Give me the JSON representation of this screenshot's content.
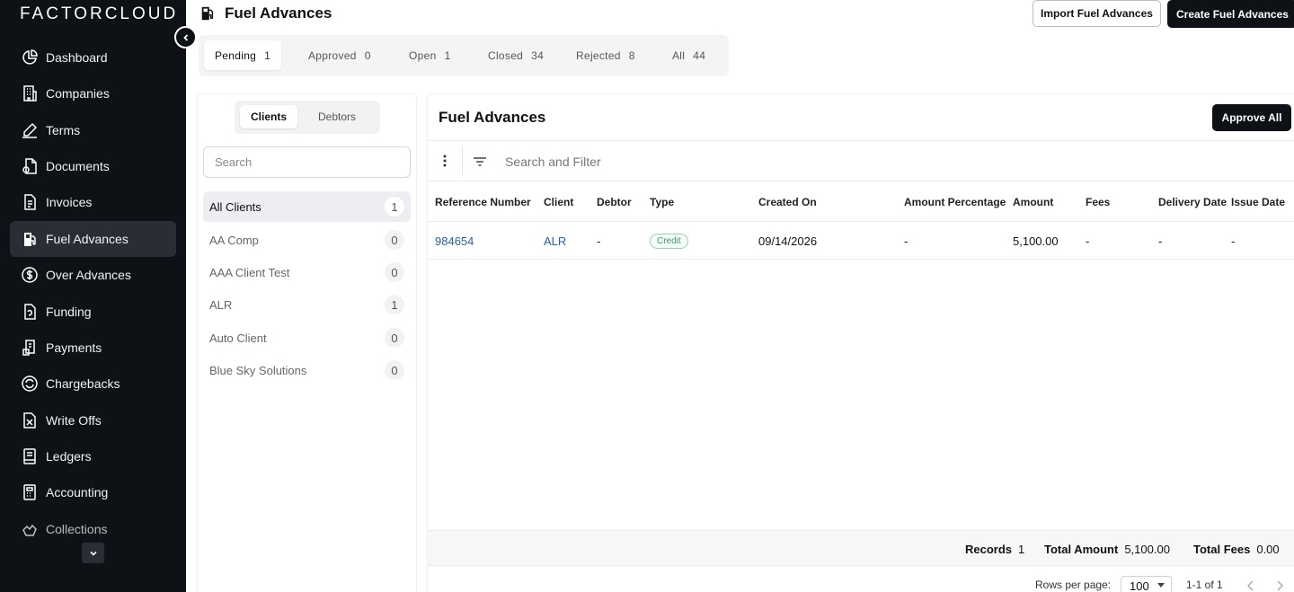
{
  "app": {
    "logo": "FACTORCLOUD"
  },
  "sidebar": {
    "items": [
      {
        "label": "Dashboard",
        "icon": "dashboard-pie-icon"
      },
      {
        "label": "Companies",
        "icon": "building-icon"
      },
      {
        "label": "Terms",
        "icon": "pen-signature-icon"
      },
      {
        "label": "Documents",
        "icon": "documents-icon"
      },
      {
        "label": "Invoices",
        "icon": "invoice-icon"
      },
      {
        "label": "Fuel Advances",
        "icon": "fuel-pump-icon",
        "active": true
      },
      {
        "label": "Over Advances",
        "icon": "dollar-circle-icon"
      },
      {
        "label": "Funding",
        "icon": "funding-icon"
      },
      {
        "label": "Payments",
        "icon": "payments-icon"
      },
      {
        "label": "Chargebacks",
        "icon": "chargeback-icon"
      },
      {
        "label": "Write Offs",
        "icon": "write-off-icon"
      },
      {
        "label": "Ledgers",
        "icon": "ledger-icon"
      },
      {
        "label": "Accounting",
        "icon": "calculator-icon"
      },
      {
        "label": "Collections",
        "icon": "collections-icon"
      }
    ]
  },
  "header": {
    "title": "Fuel Advances",
    "import_label": "Import Fuel Advances",
    "create_label": "Create Fuel Advances"
  },
  "status_tabs": [
    {
      "label": "Pending",
      "count": "1",
      "active": true
    },
    {
      "label": "Approved",
      "count": "0"
    },
    {
      "label": "Open",
      "count": "1"
    },
    {
      "label": "Closed",
      "count": "34"
    },
    {
      "label": "Rejected",
      "count": "8"
    },
    {
      "label": "All",
      "count": "44"
    }
  ],
  "clients_panel": {
    "segments": [
      "Clients",
      "Debtors"
    ],
    "search_placeholder": "Search",
    "items": [
      {
        "name": "All Clients",
        "count": "1",
        "active": true
      },
      {
        "name": "AA Comp",
        "count": "0"
      },
      {
        "name": "AAA Client Test",
        "count": "0"
      },
      {
        "name": "ALR",
        "count": "1"
      },
      {
        "name": "Auto Client",
        "count": "0"
      },
      {
        "name": "Blue Sky Solutions",
        "count": "0"
      }
    ]
  },
  "table_panel": {
    "title": "Fuel Advances",
    "approve_all_label": "Approve All",
    "search_placeholder": "Search and Filter",
    "columns": [
      "Reference Number",
      "Client",
      "Debtor",
      "Type",
      "Created On",
      "Amount Percentage",
      "Amount",
      "Fees",
      "Delivery Date",
      "Issue Date"
    ],
    "rows": [
      {
        "reference": "984654",
        "client": "ALR",
        "debtor": "-",
        "type": "Credit",
        "created_on": "09/14/2026",
        "amount_percentage": "-",
        "amount": "5,100.00",
        "fees": "-",
        "delivery_date": "-",
        "issue_date": "-"
      }
    ],
    "totals": {
      "records_label": "Records",
      "records": "1",
      "amount_label": "Total Amount",
      "amount": "5,100.00",
      "fees_label": "Total Fees",
      "fees": "0.00"
    },
    "pagination": {
      "rows_per_page_label": "Rows per page:",
      "rows_per_page": "100",
      "range": "1-1 of 1"
    }
  },
  "colors": {
    "sidebar_bg": "#0e1116",
    "active_nav": "#2a2d33",
    "link": "#2b5fa8",
    "credit_pill": "#3f9c6b"
  }
}
